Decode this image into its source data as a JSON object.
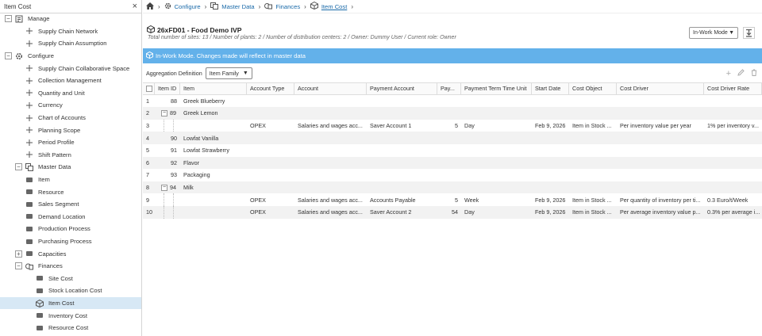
{
  "sidebar": {
    "title": "Item Cost",
    "close": "×",
    "items": [
      {
        "label": "Manage",
        "level": 0,
        "toggle": "−",
        "icon": "manage-icon"
      },
      {
        "label": "Supply Chain Network",
        "level": 1,
        "icon": "network-icon"
      },
      {
        "label": "Supply Chain Assumption",
        "level": 1,
        "icon": "assumption-icon"
      },
      {
        "label": "Configure",
        "level": 0,
        "toggle": "−",
        "icon": "gear-icon"
      },
      {
        "label": "Supply Chain Collaborative Space",
        "level": 1,
        "icon": "collab-icon"
      },
      {
        "label": "Collection Management",
        "level": 1,
        "icon": "collection-icon"
      },
      {
        "label": "Quantity and Unit",
        "level": 1,
        "icon": "quantity-icon"
      },
      {
        "label": "Currency",
        "level": 1,
        "icon": "currency-icon"
      },
      {
        "label": "Chart of Accounts",
        "level": 1,
        "icon": "accounts-icon"
      },
      {
        "label": "Planning Scope",
        "level": 1,
        "icon": "scope-icon"
      },
      {
        "label": "Period Profile",
        "level": 1,
        "icon": "period-icon"
      },
      {
        "label": "Shift Pattern",
        "level": 1,
        "icon": "shift-icon"
      },
      {
        "label": "Master Data",
        "level": 1,
        "toggle": "−",
        "icon": "masterdata-icon"
      },
      {
        "label": "Item",
        "level": 2,
        "icon": "item-icon"
      },
      {
        "label": "Resource",
        "level": 2,
        "icon": "resource-icon"
      },
      {
        "label": "Sales Segment",
        "level": 2,
        "icon": "segment-icon"
      },
      {
        "label": "Demand Location",
        "level": 2,
        "icon": "location-icon"
      },
      {
        "label": "Production Process",
        "level": 2,
        "icon": "production-icon"
      },
      {
        "label": "Purchasing Process",
        "level": 2,
        "icon": "purchasing-icon"
      },
      {
        "label": "Capacities",
        "level": 2,
        "toggle": "+",
        "icon": "capacities-icon"
      },
      {
        "label": "Finances",
        "level": 2,
        "toggle": "−",
        "icon": "finances-icon"
      },
      {
        "label": "Site Cost",
        "level": 3,
        "icon": "site-cost-icon"
      },
      {
        "label": "Stock Location Cost",
        "level": 3,
        "icon": "stock-location-icon"
      },
      {
        "label": "Item Cost",
        "level": 3,
        "icon": "item-cost-icon",
        "selected": true
      },
      {
        "label": "Inventory Cost",
        "level": 3,
        "icon": "inventory-icon"
      },
      {
        "label": "Resource Cost",
        "level": 3,
        "icon": "resource-cost-icon"
      }
    ]
  },
  "breadcrumb": {
    "items": [
      "Configure",
      "Master Data",
      "Finances",
      "Item Cost"
    ]
  },
  "header": {
    "title": "26xFD01 - Food Demo IVP",
    "subtitle": "Total number of sites: 13 / Number of plants: 2 / Number of distribution centers: 2 / Owner: Dummy User / Current role: Owner",
    "mode": "In-Work Mode"
  },
  "banner": {
    "text": "In-Work Mode. Changes made will reflect in master data"
  },
  "aggregation": {
    "label": "Aggregation Definition",
    "value": "Item Family"
  },
  "grid": {
    "columns": [
      "Item ID",
      "Item",
      "Account Type",
      "Account",
      "Payment Account",
      "Pay...",
      "Payment Term Time Unit",
      "Start Date",
      "Cost Object",
      "Cost Driver",
      "Cost Driver Rate"
    ],
    "rows": [
      {
        "n": "1",
        "id": "88",
        "item": "Greek Blueberry",
        "at": "",
        "acc": "",
        "pa": "",
        "pay": "",
        "ptu": "",
        "sd": "",
        "co": "",
        "cd": "",
        "cdr": ""
      },
      {
        "n": "2",
        "id": "89",
        "item": "Greek Lemon",
        "tog": "−",
        "at": "",
        "acc": "",
        "pa": "",
        "pay": "",
        "ptu": "",
        "sd": "",
        "co": "",
        "cd": "",
        "cdr": ""
      },
      {
        "n": "3",
        "id": "",
        "item": "",
        "at": "OPEX",
        "acc": "Salaries and wages acc...",
        "pa": "Saver Account 1",
        "pay": "5",
        "ptu": "Day",
        "sd": "Feb 9, 2026",
        "co": "Item in Stock ...",
        "cd": "Per inventory value per year",
        "cdr": "1% per inventory v...",
        "child": true
      },
      {
        "n": "4",
        "id": "90",
        "item": "Lowfat Vanilla",
        "at": "",
        "acc": "",
        "pa": "",
        "pay": "",
        "ptu": "",
        "sd": "",
        "co": "",
        "cd": "",
        "cdr": ""
      },
      {
        "n": "5",
        "id": "91",
        "item": "Lowfat Strawberry",
        "at": "",
        "acc": "",
        "pa": "",
        "pay": "",
        "ptu": "",
        "sd": "",
        "co": "",
        "cd": "",
        "cdr": ""
      },
      {
        "n": "6",
        "id": "92",
        "item": "Flavor",
        "at": "",
        "acc": "",
        "pa": "",
        "pay": "",
        "ptu": "",
        "sd": "",
        "co": "",
        "cd": "",
        "cdr": ""
      },
      {
        "n": "7",
        "id": "93",
        "item": "Packaging",
        "at": "",
        "acc": "",
        "pa": "",
        "pay": "",
        "ptu": "",
        "sd": "",
        "co": "",
        "cd": "",
        "cdr": ""
      },
      {
        "n": "8",
        "id": "94",
        "item": "Milk",
        "tog": "−",
        "at": "",
        "acc": "",
        "pa": "",
        "pay": "",
        "ptu": "",
        "sd": "",
        "co": "",
        "cd": "",
        "cdr": ""
      },
      {
        "n": "9",
        "id": "",
        "item": "",
        "at": "OPEX",
        "acc": "Salaries and wages acc...",
        "pa": "Accounts Payable",
        "pay": "5",
        "ptu": "Week",
        "sd": "Feb 9, 2026",
        "co": "Item in Stock ...",
        "cd": "Per quantity of inventory per ti...",
        "cdr": "0.3 Euro/t/Week",
        "child": true
      },
      {
        "n": "10",
        "id": "",
        "item": "",
        "at": "OPEX",
        "acc": "Salaries and wages acc...",
        "pa": "Saver Account 2",
        "pay": "54",
        "ptu": "Day",
        "sd": "Feb 9, 2026",
        "co": "Item in Stock ...",
        "cd": "Per average inventory value p...",
        "cdr": "0.3% per average i...",
        "child": true
      }
    ]
  }
}
